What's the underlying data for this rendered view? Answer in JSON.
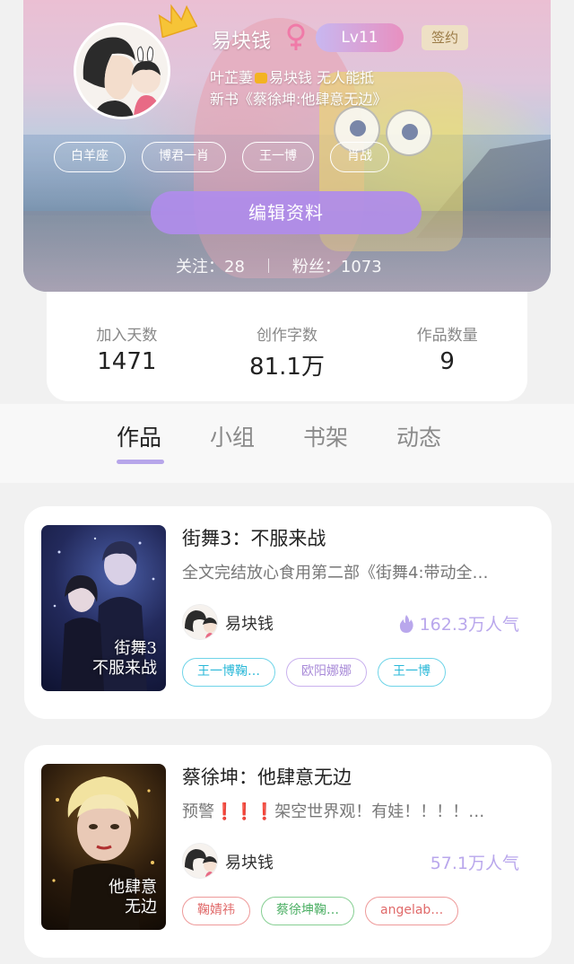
{
  "profile": {
    "username": "易块钱",
    "level": "Lv11",
    "sign_badge": "签约",
    "bio_line1_a": "叶芷萋",
    "bio_line1_b": "易块钱 无人能抵",
    "bio_line2": "新书《蔡徐坤:他肆意无边》",
    "tags": [
      "白羊座",
      "博君一肖",
      "王一博",
      "肖战"
    ],
    "edit_button": "编辑资料",
    "following": "关注：28",
    "fans": "粉丝：1073"
  },
  "stats": [
    {
      "label": "加入天数",
      "value": "1471"
    },
    {
      "label": "创作字数",
      "value": "81.1万"
    },
    {
      "label": "作品数量",
      "value": "9"
    }
  ],
  "tabs": [
    "作品",
    "小组",
    "书架",
    "动态"
  ],
  "works": [
    {
      "title": "街舞3：不服来战",
      "desc": "全文完结放心食用第二部《街舞4:带动全…",
      "author": "易块钱",
      "popularity": "162.3万人气",
      "cover_text_1": "街舞3",
      "cover_text_2": "不服来战",
      "tags": [
        "王一博鞠…",
        "欧阳娜娜",
        "王一博"
      ]
    },
    {
      "title": "蔡徐坤：他肆意无边",
      "desc": "预警❗❗❗架空世界观！有娃！！！！…",
      "author": "易块钱",
      "popularity": "57.1万人气",
      "cover_text_1": "他肆意",
      "cover_text_2": "无边",
      "tags": [
        "鞠婧祎",
        "蔡徐坤鞠…",
        "angelab…"
      ]
    }
  ],
  "colors": {
    "accent": "#b7a6ea",
    "edit_button": "#b08ceb",
    "level_gradient_start": "#c8b7f0",
    "level_gradient_end": "#e890c0"
  }
}
